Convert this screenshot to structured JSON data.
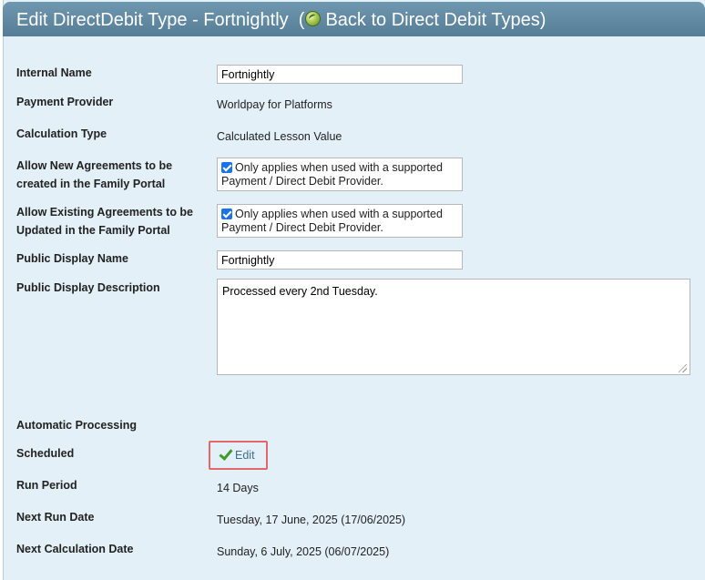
{
  "header": {
    "title": "Edit DirectDebit Type - Fortnightly",
    "back_link": "Back to Direct Debit Types",
    "open_paren": "(",
    "close_paren": ")"
  },
  "form": {
    "internal_name": {
      "label": "Internal Name",
      "value": "Fortnightly"
    },
    "payment_provider": {
      "label": "Payment Provider",
      "value": "Worldpay for Platforms"
    },
    "calculation_type": {
      "label": "Calculation Type",
      "value": "Calculated Lesson Value"
    },
    "allow_new": {
      "label_line1": "Allow New Agreements to be",
      "label_line2": "created in the Family Portal",
      "checked": true,
      "text_line1": "Only applies when used with a supported",
      "text_line2": "Payment / Direct Debit Provider."
    },
    "allow_existing": {
      "label_line1": "Allow Existing Agreements to be",
      "label_line2": "Updated in the Family Portal",
      "checked": true,
      "text_line1": "Only applies when used with a supported",
      "text_line2": "Payment / Direct Debit Provider."
    },
    "public_display_name": {
      "label": "Public Display Name",
      "value": "Fortnightly"
    },
    "public_display_description": {
      "label": "Public Display Description",
      "value": "Processed every 2nd Tuesday."
    }
  },
  "automatic_processing": {
    "heading": "Automatic Processing",
    "scheduled": {
      "label": "Scheduled",
      "edit_label": "Edit"
    },
    "run_period": {
      "label": "Run Period",
      "value": "14 Days"
    },
    "next_run_date": {
      "label": "Next Run Date",
      "value": "Tuesday, 17 June, 2025 (17/06/2025)"
    },
    "next_calculation_date": {
      "label": "Next Calculation Date",
      "value": "Sunday, 6 July, 2025 (06/07/2025)"
    }
  },
  "colors": {
    "header_bg": "#6289a2",
    "panel_bg": "#e3f0f7",
    "highlight_border": "#e0676c",
    "link_text": "#3d6f8c",
    "check_green": "#3f9a2c"
  }
}
